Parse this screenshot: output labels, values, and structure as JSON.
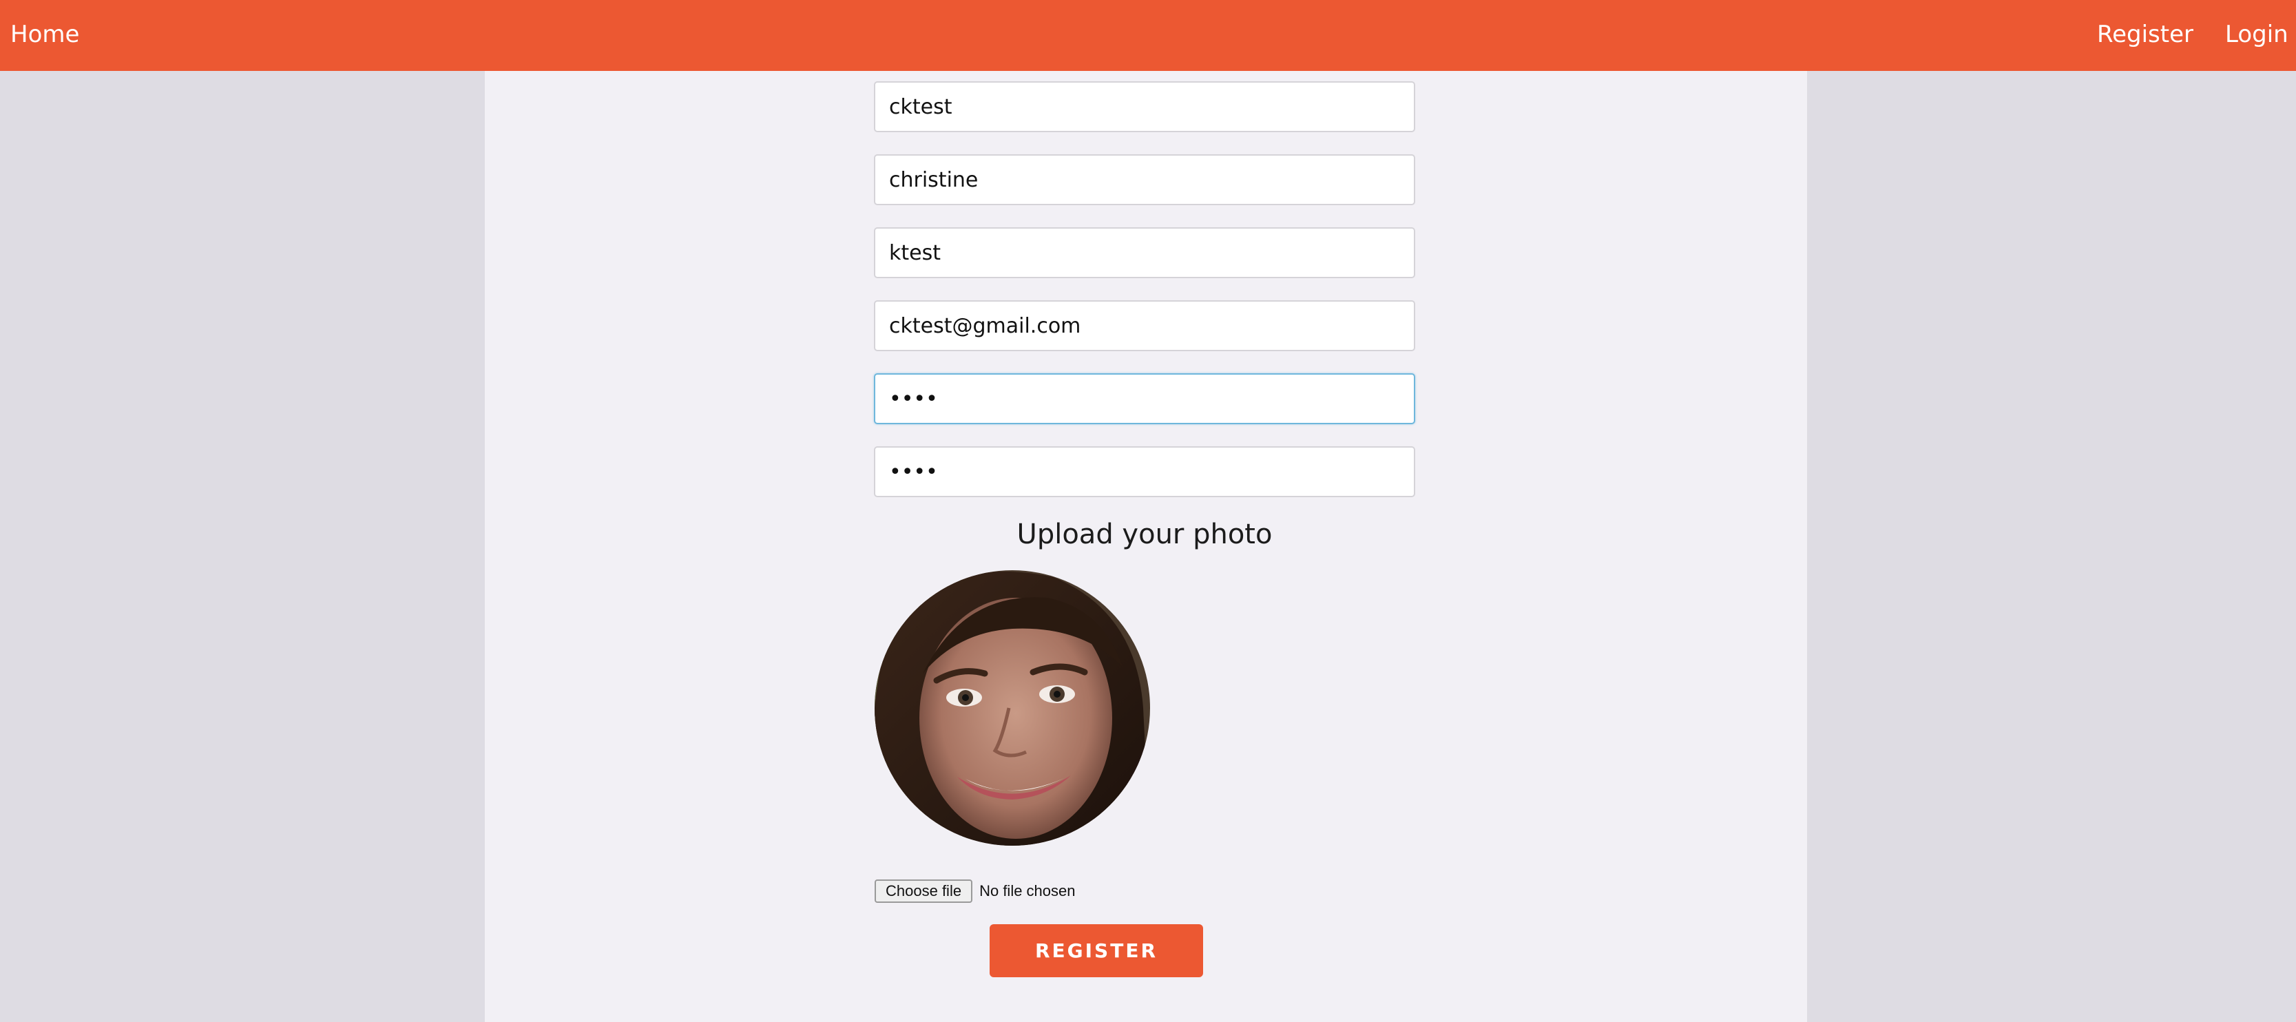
{
  "nav": {
    "home": "Home",
    "register": "Register",
    "login": "Login",
    "color": "#ec5832"
  },
  "form": {
    "username": {
      "value": "cktest"
    },
    "first_name": {
      "value": "christine"
    },
    "last_name": {
      "value": "ktest"
    },
    "email": {
      "value": "cktest@gmail.com"
    },
    "password": {
      "value": "••••"
    },
    "confirm_password": {
      "value": "••••"
    },
    "upload_title": "Upload your photo",
    "file_button": "Choose file",
    "file_status": "No file chosen",
    "submit_label": "REGISTER"
  }
}
